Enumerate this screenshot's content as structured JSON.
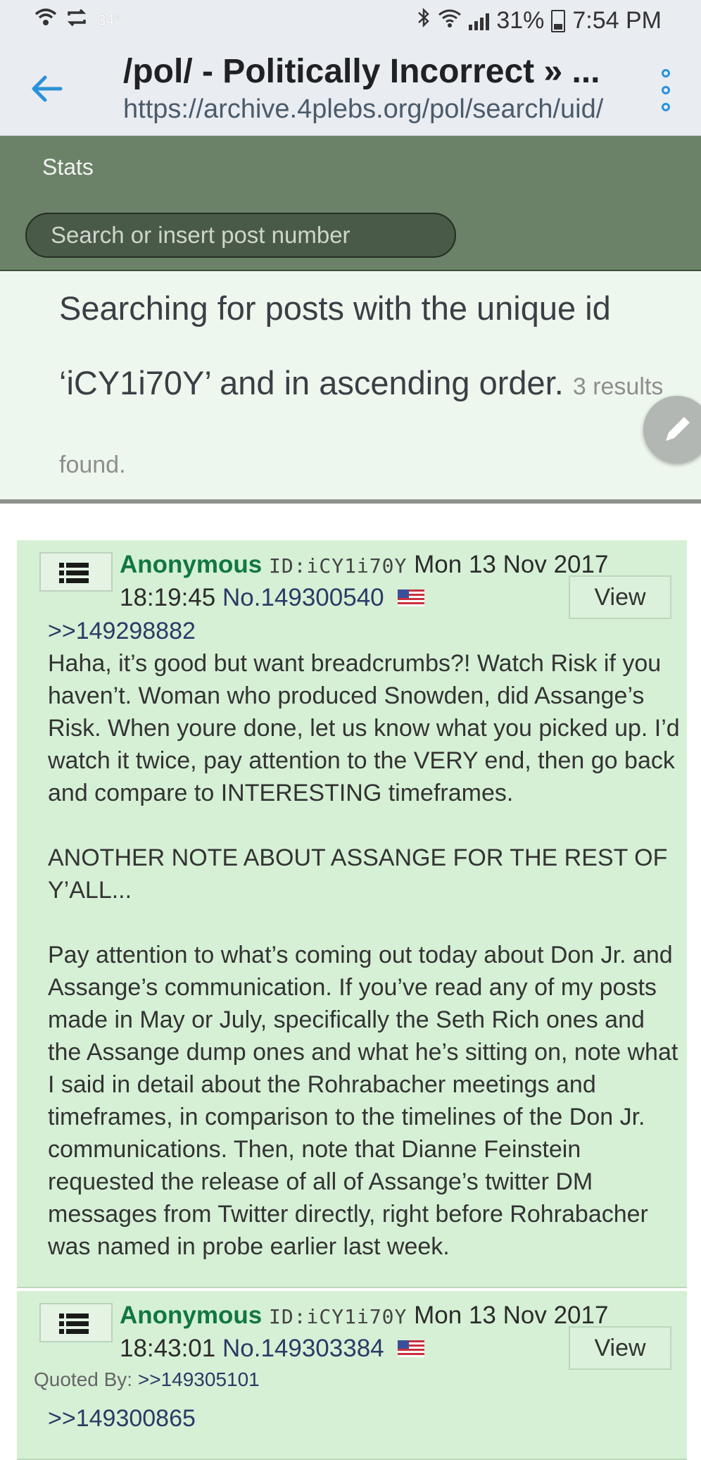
{
  "status_bar": {
    "temperature": "34°",
    "battery": "31%",
    "time": "7:54 PM"
  },
  "app_bar": {
    "title": "/pol/ - Politically Incorrect » ...",
    "url": "https://archive.4plebs.org/pol/search/uid/"
  },
  "header": {
    "stats_label": "Stats",
    "search_placeholder": "Search or insert post number"
  },
  "search_info": {
    "line1": "Searching for posts with the unique id",
    "line2": "‘iCY1i70Y’ and in ascending order.",
    "count_a": "3 results",
    "count_b": "found."
  },
  "posts": [
    {
      "name": "Anonymous",
      "uid": "ID:iCY1i70Y",
      "date": "Mon 13 Nov 2017",
      "time": "18:19:45",
      "number": "No.149300540",
      "view_label": "View",
      "reply_to": ">>149298882",
      "body": [
        "Haha, it’s good but want breadcrumbs?! Watch Risk if you haven’t. Woman who produced Snowden, did Assange’s Risk. When youre done, let us know what you picked up. I’d watch it twice, pay attention to the VERY end, then go back and compare to INTERESTING timeframes.",
        "ANOTHER NOTE ABOUT ASSANGE FOR THE REST OF Y’ALL...",
        "Pay attention to what’s coming out today about Don Jr. and Assange’s communication. If you’ve read any of my posts made in May or July, specifically the Seth Rich ones and the Assange dump ones and what he’s sitting on, note what I said in detail about the Rohrabacher meetings and timeframes, in comparison to the timelines of the Don Jr. communications. Then, note that Dianne Feinstein requested the release of all of Assange’s twitter DM messages from Twitter directly, right before Rohrabacher was named in probe earlier last week."
      ]
    },
    {
      "name": "Anonymous",
      "uid": "ID:iCY1i70Y",
      "date": "Mon 13 Nov 2017",
      "time": "18:43:01",
      "number": "No.149303384",
      "view_label": "View",
      "quoted_by_label": "Quoted By:",
      "quoted_by": ">>149305101",
      "reply_to": ">>149300865"
    }
  ]
}
